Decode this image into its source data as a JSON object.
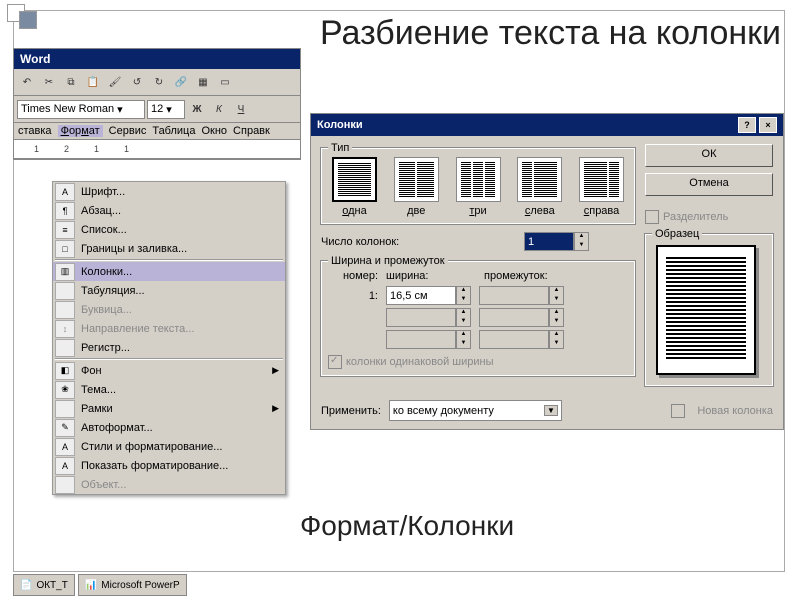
{
  "slide": {
    "title": "Разбиение текста на колонки",
    "footer": "Формат/Колонки"
  },
  "word": {
    "title": "Word",
    "font_name": "Times New Roman",
    "font_size": "12",
    "menubar": [
      "ставка",
      "Формат",
      "Сервис",
      "Таблица",
      "Окно",
      "Справк"
    ],
    "format_menu": [
      {
        "label": "Шрифт...",
        "icon": "A"
      },
      {
        "label": "Абзац...",
        "icon": "¶"
      },
      {
        "label": "Список...",
        "icon": "≡"
      },
      {
        "label": "Границы и заливка...",
        "icon": "□"
      },
      {
        "sep": true
      },
      {
        "label": "Колонки...",
        "icon": "▥",
        "highlight": true
      },
      {
        "label": "Табуляция..."
      },
      {
        "label": "Буквица...",
        "disabled": true
      },
      {
        "label": "Направление текста...",
        "icon": "↕",
        "disabled": true
      },
      {
        "label": "Регистр..."
      },
      {
        "sep": true
      },
      {
        "label": "Фон",
        "icon": "◧",
        "arrow": true
      },
      {
        "label": "Тема...",
        "icon": "❀"
      },
      {
        "label": "Рамки",
        "arrow": true
      },
      {
        "label": "Автоформат...",
        "icon": "✎"
      },
      {
        "label": "Стили и форматирование...",
        "icon": "A"
      },
      {
        "label": "Показать форматирование...",
        "icon": "A"
      },
      {
        "label": "Объект...",
        "disabled": true
      }
    ]
  },
  "dialog": {
    "title": "Колонки",
    "ok": "ОК",
    "cancel": "Отмена",
    "type_label": "Тип",
    "presets": [
      {
        "label": "одна",
        "cols": 1,
        "selected": true
      },
      {
        "label": "две",
        "cols": 2
      },
      {
        "label": "три",
        "cols": 3
      },
      {
        "label": "слева",
        "cols": 2,
        "left_narrow": true
      },
      {
        "label": "справа",
        "cols": 2,
        "right_narrow": true
      }
    ],
    "count_label": "Число колонок:",
    "count_value": "1",
    "separator_label": "Разделитель",
    "width_group": "Ширина и промежуток",
    "col_number": "номер:",
    "col_width": "ширина:",
    "col_gap": "промежуток:",
    "row1_num": "1:",
    "row1_width": "16,5 см",
    "equal_label": "колонки одинаковой ширины",
    "preview_label": "Образец",
    "apply_label": "Применить:",
    "apply_value": "ко всему документу",
    "newcol_label": "Новая колонка"
  },
  "taskbar": {
    "item1": "ОКТ_Т",
    "item2": "Microsoft PowerP"
  }
}
